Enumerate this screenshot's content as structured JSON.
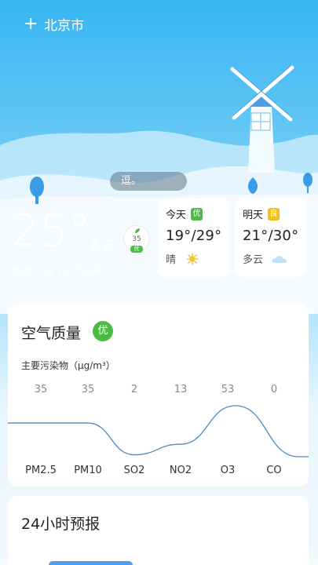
{
  "header": {
    "city": "北京市",
    "add_icon": "plus-icon"
  },
  "notice": {
    "text": "逗。"
  },
  "current": {
    "temperature": "25°",
    "condition": "多云",
    "publish_time": "08月31日 10:55发布",
    "aqi": {
      "value": "35",
      "level": "优",
      "color": "#4cbb45"
    }
  },
  "forecast": [
    {
      "day": "今天",
      "aqi_level": "优",
      "aqi_color": "#4cbb45",
      "range": "19°/29°",
      "condition": "晴",
      "icon": "sun-icon"
    },
    {
      "day": "明天",
      "aqi_level": "良",
      "aqi_color": "#f3c11b",
      "range": "21°/30°",
      "condition": "多云",
      "icon": "cloud-icon"
    }
  ],
  "air_quality": {
    "title": "空气质量",
    "level": "优",
    "level_color": "#4cbb45",
    "pollutant_label": "主要污染物（μg/m³）",
    "line_color": "#4a8cc4",
    "pollutants": [
      {
        "name": "PM2.5",
        "value": "35"
      },
      {
        "name": "PM10",
        "value": "35"
      },
      {
        "name": "SO2",
        "value": "2"
      },
      {
        "name": "NO2",
        "value": "13"
      },
      {
        "name": "O3",
        "value": "53"
      },
      {
        "name": "CO",
        "value": "0"
      }
    ]
  },
  "hourly": {
    "title": "24小时预报",
    "accent": "#4f9df0"
  }
}
